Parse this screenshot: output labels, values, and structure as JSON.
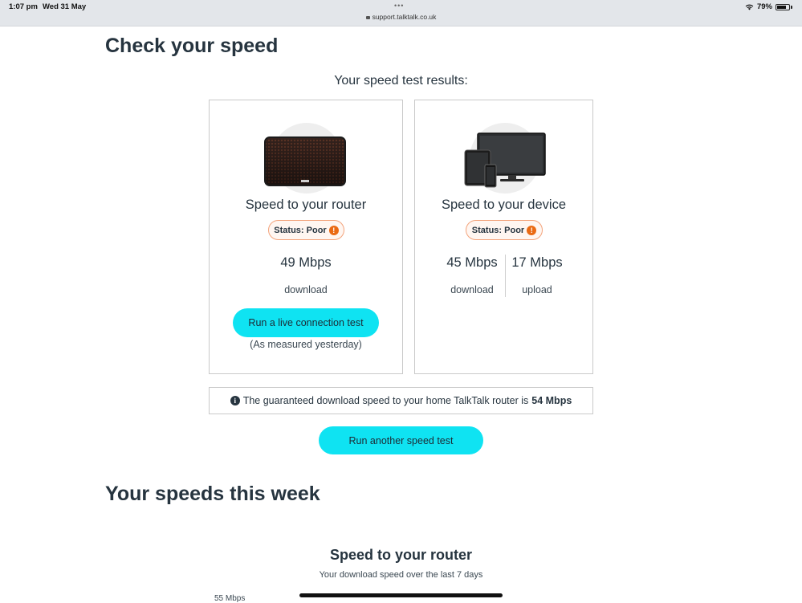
{
  "status_bar": {
    "time": "1:07 pm",
    "date": "Wed 31 May",
    "dots": "•••",
    "url": "support.talktalk.co.uk",
    "battery": "79%"
  },
  "page": {
    "title": "Check your speed",
    "results_title": "Your speed test results:",
    "router_card": {
      "image": "router-image",
      "title": "Speed to your router",
      "status": "Status: Poor",
      "download_speed": "49 Mbps",
      "download_label": "download",
      "button_label": "Run a live connection test",
      "note": "(As measured yesterday)"
    },
    "device_card": {
      "image": "devices-image",
      "title": "Speed to your device",
      "status": "Status: Poor",
      "download_speed": "45 Mbps",
      "download_label": "download",
      "upload_speed": "17 Mbps",
      "upload_label": "upload"
    },
    "guarantee": {
      "text": "The guaranteed download speed to your home TalkTalk router is",
      "value": "54 Mbps"
    },
    "another_test_label": "Run another speed test",
    "week_title": "Your speeds this week",
    "chart": {
      "title": "Speed to your router",
      "subtitle": "Your download speed over the last 7 days",
      "y_tick_top": "55 Mbps"
    }
  },
  "colors": {
    "accent": "#0fe3f2",
    "warning": "#ea6a13",
    "text": "#26343f"
  }
}
